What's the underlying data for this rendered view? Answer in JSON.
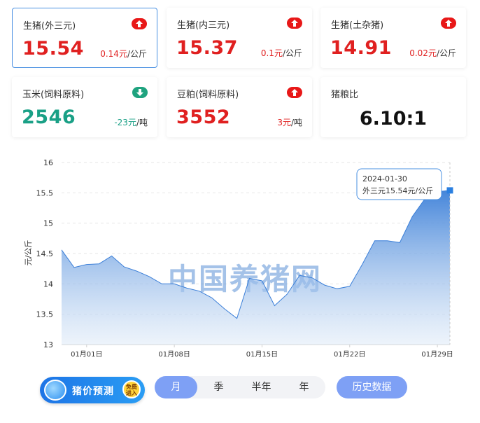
{
  "cards": [
    {
      "name": "生猪(外三元)",
      "price": "15.54",
      "change": "0.14元",
      "unit": "/公斤",
      "direction": "up"
    },
    {
      "name": "生猪(内三元)",
      "price": "15.37",
      "change": "0.1元",
      "unit": "/公斤",
      "direction": "up"
    },
    {
      "name": "生猪(土杂猪)",
      "price": "14.91",
      "change": "0.02元",
      "unit": "/公斤",
      "direction": "up"
    },
    {
      "name": "玉米(饲料原料)",
      "price": "2546",
      "change": "-23元",
      "unit": "/吨",
      "direction": "down"
    },
    {
      "name": "豆粕(饲料原料)",
      "price": "3552",
      "change": "3元",
      "unit": "/吨",
      "direction": "up"
    },
    {
      "name": "猪粮比",
      "ratio": "6.10:1"
    }
  ],
  "colors": {
    "up": "#e02020",
    "down": "#1aa086",
    "accent": "#4a90e2",
    "tab_active": "#7ea0f5"
  },
  "chart_data": {
    "type": "area",
    "ylabel": "元/公斤",
    "ylim": [
      13,
      16
    ],
    "yticks": [
      "16",
      "15.5",
      "15",
      "14.5",
      "14",
      "13.5",
      "13"
    ],
    "xtick_labels": [
      "01月01日",
      "01月08日",
      "01月15日",
      "01月22日",
      "01月29日"
    ],
    "watermark": "中国养猪网",
    "x": [
      "2023-12-30",
      "2023-12-31",
      "2024-01-01",
      "2024-01-02",
      "2024-01-03",
      "2024-01-04",
      "2024-01-05",
      "2024-01-06",
      "2024-01-07",
      "2024-01-08",
      "2024-01-09",
      "2024-01-10",
      "2024-01-11",
      "2024-01-12",
      "2024-01-13",
      "2024-01-14",
      "2024-01-15",
      "2024-01-16",
      "2024-01-17",
      "2024-01-18",
      "2024-01-19",
      "2024-01-20",
      "2024-01-21",
      "2024-01-22",
      "2024-01-23",
      "2024-01-24",
      "2024-01-25",
      "2024-01-26",
      "2024-01-27",
      "2024-01-28",
      "2024-01-29",
      "2024-01-30"
    ],
    "series": [
      {
        "values": [
          14.56,
          14.27,
          14.32,
          14.33,
          14.46,
          14.28,
          14.21,
          14.12,
          14.0,
          14.0,
          13.93,
          13.88,
          13.77,
          13.59,
          13.43,
          14.09,
          14.05,
          13.64,
          13.83,
          14.14,
          14.1,
          13.98,
          13.92,
          13.96,
          14.32,
          14.71,
          14.71,
          14.68,
          15.11,
          15.4,
          15.52,
          15.54
        ]
      }
    ],
    "tooltip": {
      "date": "2024-01-30",
      "text": "外三元15.54元/公斤"
    }
  },
  "tabs": [
    "月",
    "季",
    "半年",
    "年"
  ],
  "active_tab": "月",
  "history_button": "历史数据",
  "logo_text": "猪价预测",
  "logo_stamp": "免费进入"
}
